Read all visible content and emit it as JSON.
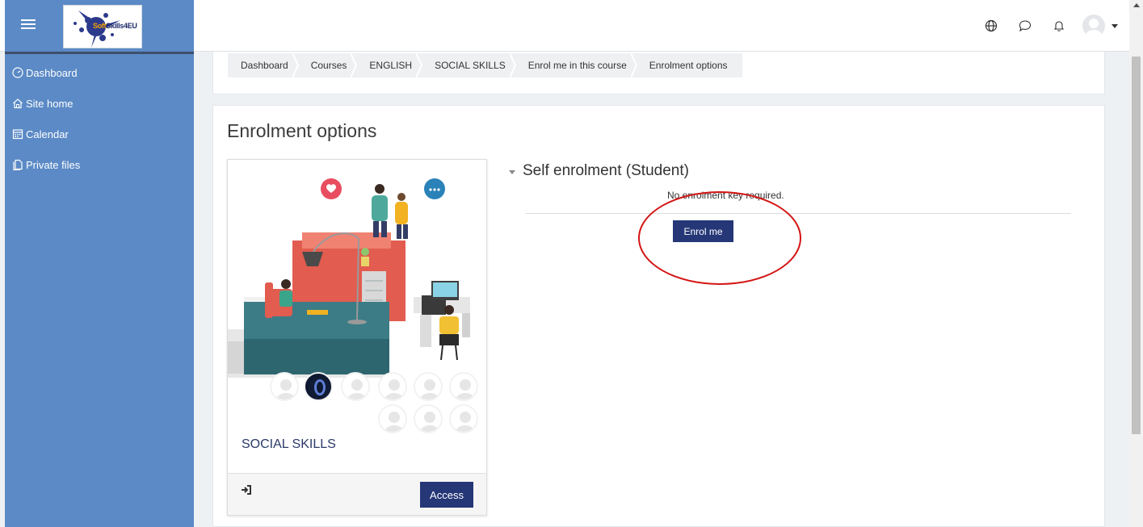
{
  "navbar": {
    "logo_text_a": "Soft",
    "logo_text_b": "Skills4EU",
    "icons": [
      "globe-icon",
      "chat-icon",
      "bell-icon",
      "user-avatar"
    ]
  },
  "sidebar": {
    "items": [
      {
        "label": "Dashboard",
        "icon": "dashboard-icon"
      },
      {
        "label": "Site home",
        "icon": "home-icon"
      },
      {
        "label": "Calendar",
        "icon": "calendar-icon"
      },
      {
        "label": "Private files",
        "icon": "files-icon"
      }
    ]
  },
  "breadcrumb": [
    "Dashboard",
    "Courses",
    "ENGLISH",
    "SOCIAL SKILLS",
    "Enrol me in this course",
    "Enrolment options"
  ],
  "main": {
    "title": "Enrolment options",
    "course": {
      "name": "SOCIAL SKILLS",
      "access_label": "Access"
    },
    "self_enrolment": {
      "title": "Self enrolment (Student)",
      "note": "No enrolment key required.",
      "enrol_label": "Enrol me"
    }
  },
  "colors": {
    "sidebar": "#5b8ac6",
    "primary_button": "#253777",
    "highlight": "#d41515"
  }
}
